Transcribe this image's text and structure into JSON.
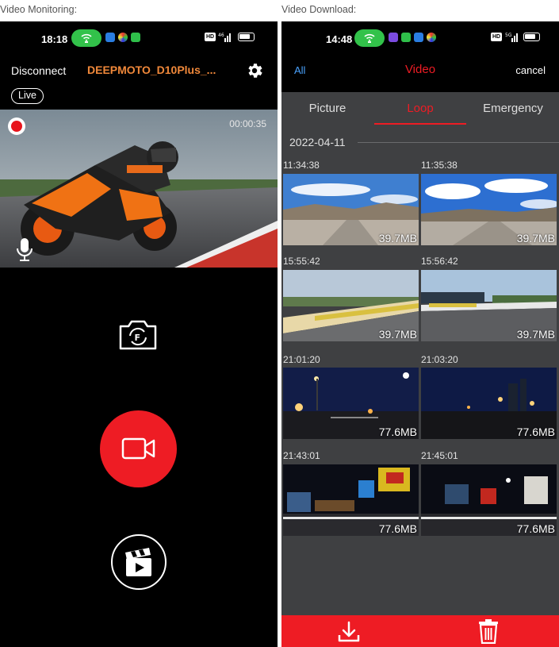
{
  "captions": {
    "left": "Video Monitoring:",
    "right": "Video Download:"
  },
  "left_phone": {
    "status": {
      "time": "18:18",
      "net": "⁴⁶ᴳ"
    },
    "header": {
      "disconnect_label": "Disconnect",
      "device_name": "DEEPMOTO_D10Plus_..."
    },
    "live_label": "Live",
    "video": {
      "timer": "00:00:35"
    },
    "icons": [
      "settings-gear-icon",
      "record-dot-icon",
      "microphone-icon",
      "camera-switch-icon",
      "video-camera-icon",
      "clapperboard-play-icon"
    ],
    "colors": {
      "accent_red": "#ee1c24",
      "device_orange": "#f0883a"
    }
  },
  "right_phone": {
    "status": {
      "time": "14:48",
      "net": "⁵ᴳ"
    },
    "header": {
      "all_label": "All",
      "title": "Video",
      "cancel_label": "cancel"
    },
    "tabs": [
      {
        "label": "Picture",
        "active": false
      },
      {
        "label": "Loop",
        "active": true
      },
      {
        "label": "Emergency",
        "active": false
      }
    ],
    "date": "2022-04-11",
    "files": [
      {
        "time": "11:34:38",
        "size": "39.7MB"
      },
      {
        "time": "11:35:38",
        "size": "39.7MB"
      },
      {
        "time": "15:55:42",
        "size": "39.7MB"
      },
      {
        "time": "15:56:42",
        "size": "39.7MB"
      },
      {
        "time": "21:01:20",
        "size": "77.6MB"
      },
      {
        "time": "21:03:20",
        "size": "77.6MB"
      },
      {
        "time": "21:43:01",
        "size": "77.6MB"
      },
      {
        "time": "21:45:01",
        "size": "77.6MB"
      }
    ],
    "icons": [
      "download-icon",
      "trash-icon"
    ]
  }
}
